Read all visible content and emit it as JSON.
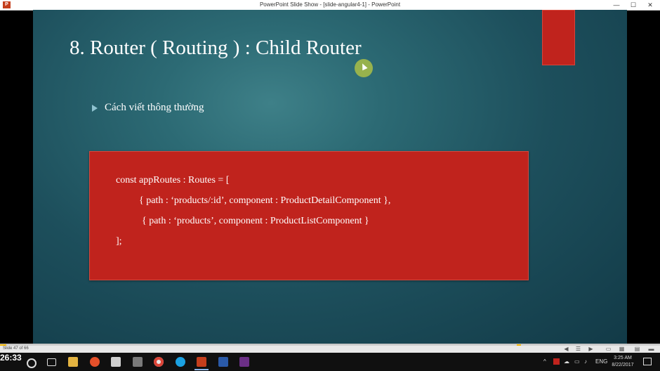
{
  "window": {
    "app_icon_label": "P",
    "title": "PowerPoint Slide Show - [slide-angular4-1] - PowerPoint",
    "minimize": "—",
    "restore": "☐",
    "close": "✕"
  },
  "slide": {
    "title": "8. Router ( Routing ) : Child Router",
    "bullet": "Cách viết thông thường",
    "code_lines": [
      "const appRoutes : Routes = [",
      "{ path : ‘products/:id’, component : ProductDetailComponent },",
      "{ path : ‘products’, component : ProductListComponent }",
      "];"
    ],
    "colors": {
      "accent_red": "#c0231d",
      "background": "#1d4f5c"
    }
  },
  "showbar": {
    "slide_counter": "Slide 47 of 66",
    "progress_fraction": 0.01,
    "icons": [
      "previous-icon",
      "menu-icon",
      "next-icon",
      "normal-view-icon",
      "slide-sorter-icon",
      "reading-view-icon",
      "slideshow-icon"
    ]
  },
  "taskbar": {
    "timer": "26:33",
    "language": "ENG",
    "time": "3:25 AM",
    "date": "8/22/2017"
  }
}
